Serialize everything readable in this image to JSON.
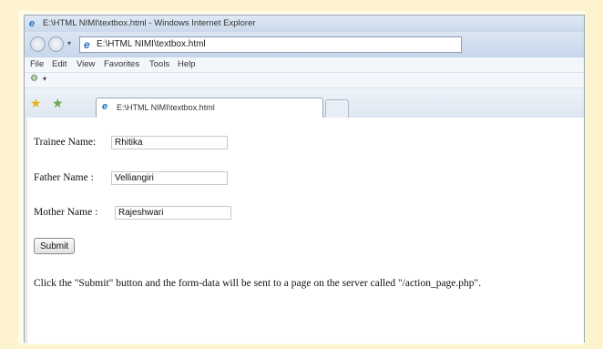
{
  "window": {
    "title": "E:\\HTML NIMI\\textbox.html - Windows Internet Explorer"
  },
  "address_bar": {
    "url": "E:\\HTML NIMI\\textbox.html"
  },
  "menu": {
    "items": [
      "File",
      "Edit",
      "View",
      "Favorites",
      "Tools",
      "Help"
    ]
  },
  "tab": {
    "title": "E:\\HTML NIMI\\textbox.html"
  },
  "form": {
    "trainee": {
      "label": "Trainee Name:",
      "value": "Rhitika"
    },
    "father": {
      "label": "Father Name :",
      "value": "Velliangiri"
    },
    "mother": {
      "label": "Mother Name :",
      "value": "Rajeshwari"
    },
    "submit_label": "Submit",
    "note": "Click the \"Submit\" button and the form-data will be sent to a page on the server called \"/action_page.php\"."
  }
}
